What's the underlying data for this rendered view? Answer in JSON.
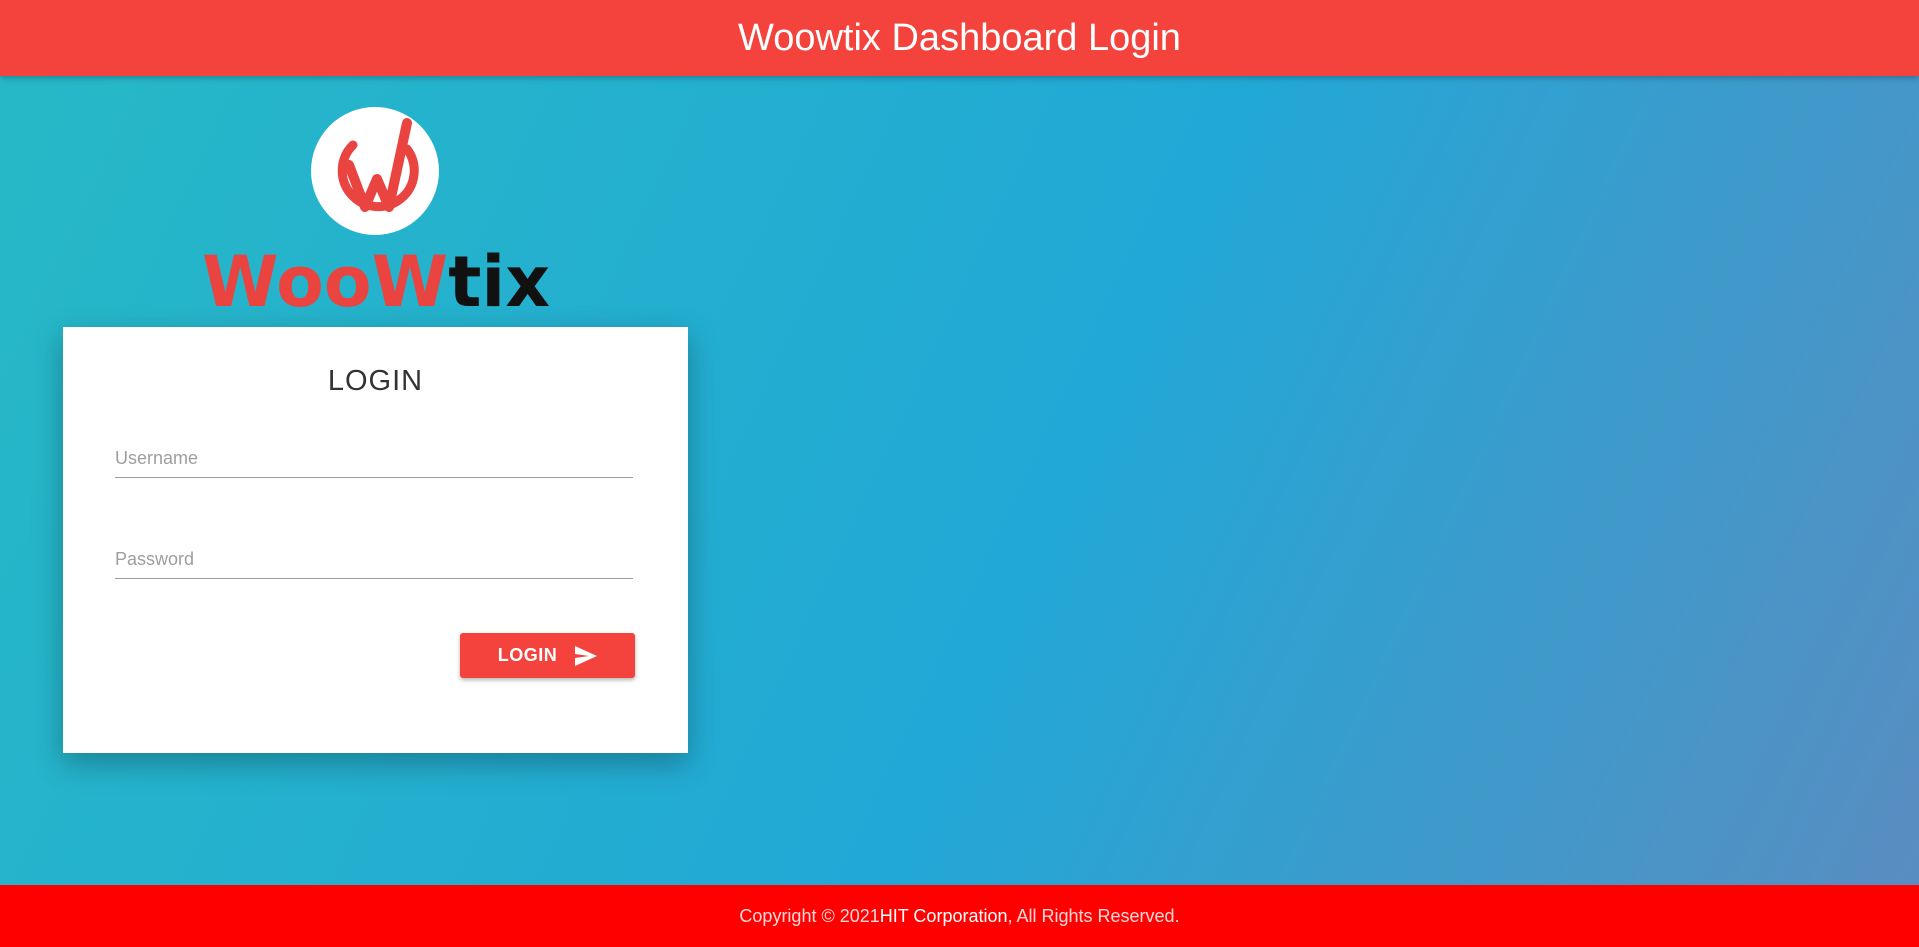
{
  "header": {
    "title": "Woowtix Dashboard Login"
  },
  "brand": {
    "wordmark_red": "WooW",
    "wordmark_dark": "tix",
    "logo_icon": "woowtix-w-logo-icon",
    "colors": {
      "red": "#f4433c",
      "dark": "#111111"
    }
  },
  "login_card": {
    "title": "LOGIN",
    "username": {
      "value": "",
      "placeholder": "Username"
    },
    "password": {
      "value": "",
      "placeholder": "Password"
    },
    "button_label": "LOGIN",
    "button_icon": "send-icon"
  },
  "footer": {
    "prefix": "Copyright © 2021 ",
    "company": "HIT Corporation",
    "suffix": ", All Rights Reserved."
  },
  "colors": {
    "accent": "#f4433c",
    "footer_bg": "#ff0000",
    "background_gradient": [
      "#26b9c6",
      "#22a8d6",
      "#5a8cc0"
    ]
  }
}
